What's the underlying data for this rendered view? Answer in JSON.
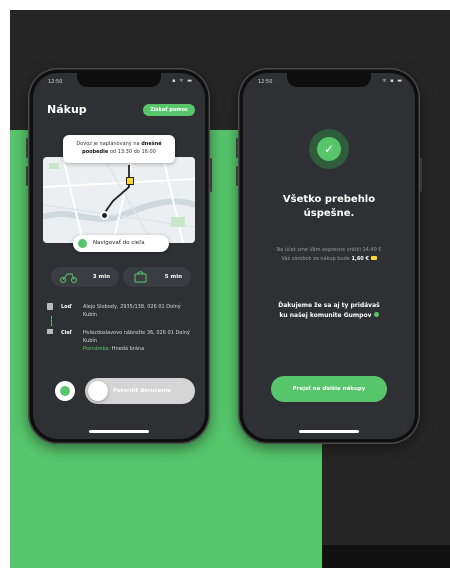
{
  "colors": {
    "accent": "#57c66b",
    "screen_bg": "#2e3034",
    "dark_bg": "#262626"
  },
  "left_phone": {
    "status_time": "12:50",
    "status_icons": "▪ ᯤ ▬",
    "title": "Nákup",
    "help_button": "Získať pomoc",
    "info_prefix": "Dovoz je naplánovaný na",
    "info_bold": "dnešné poobedie",
    "info_suffix": "od 13:30 do 16:00",
    "navigate_button": "Navigovať do cieľa",
    "time_walk": "3 min",
    "time_cart": "5 min",
    "from_label": "Loď",
    "from_address": "Alejo Slobody, 2935/138, 026 01 Dolný Kubín",
    "to_label": "Cieľ",
    "to_address": "Hviezdoslavovo nábrežie 36, 026 01 Dolný Kubín",
    "note_label": "Poznámka:",
    "note_text": "Hnedá brána",
    "confirm_slider": "Potvrdiť doručenie"
  },
  "right_phone": {
    "status_time": "12:50",
    "status_icons": "ᯤ ▪ ▬",
    "title_line1": "Všetko prebehlo",
    "title_line2": "úspešne.",
    "body_line1": "Na účet sme Vám expresne vrátili 14,40 €",
    "body_line2_prefix": "Váš zárobok za nákup bude",
    "body_amount": "1,60 €",
    "thanks_line1": "Ďakujeme že sa aj ty pridávaš",
    "thanks_line2": "ku našej komunite Gumpov",
    "next_button": "Prejsť na ďalšie nákupy"
  }
}
